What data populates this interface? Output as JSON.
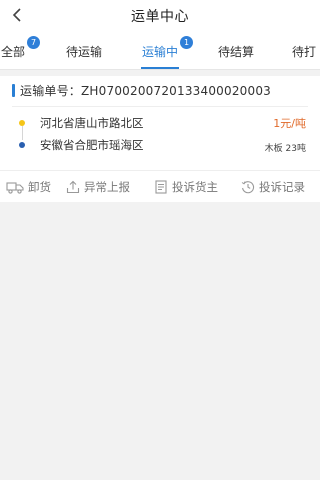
{
  "header": {
    "title": "运单中心"
  },
  "tabs": [
    {
      "label": "全部",
      "badge": "7"
    },
    {
      "label": "待运输",
      "badge": ""
    },
    {
      "label": "运输中",
      "badge": "1"
    },
    {
      "label": "待结算",
      "badge": ""
    },
    {
      "label": "待打",
      "badge": ""
    }
  ],
  "order": {
    "number_label": "运输单号：ZH07002007201334000200​03",
    "from": "河北省唐山市路北区",
    "to": "安徽省合肥市瑶海区",
    "price": "1元/吨",
    "cargo": "木板  23吨",
    "from_dot_color": "#f5c518",
    "to_dot_color": "#2a5fb0"
  },
  "actions": [
    {
      "label": "卸货",
      "icon": "truck-icon"
    },
    {
      "label": "异常上报",
      "icon": "upload-icon"
    },
    {
      "label": "投诉货主",
      "icon": "document-icon"
    },
    {
      "label": "投诉记录",
      "icon": "history-icon"
    }
  ],
  "colors": {
    "accent": "#2a7fd4",
    "price": "#e06a2a"
  }
}
